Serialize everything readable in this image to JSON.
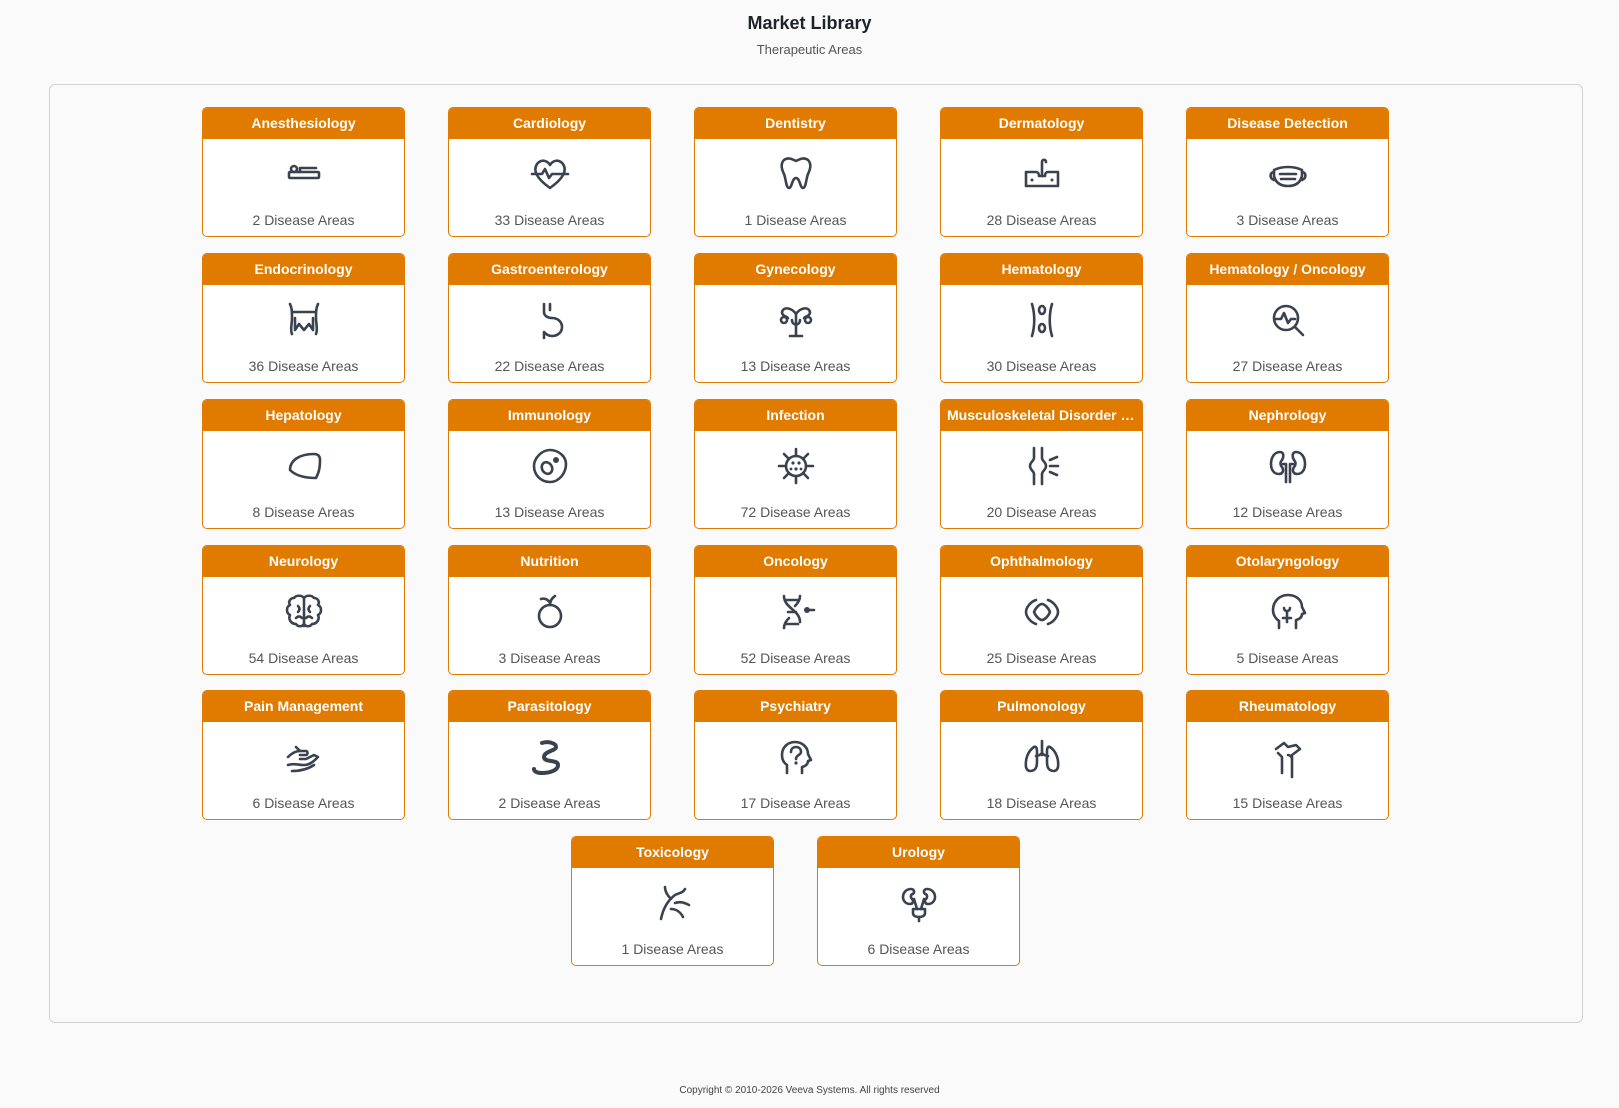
{
  "header": {
    "title": "Market Library",
    "subtitle": "Therapeutic Areas"
  },
  "areas": [
    {
      "name": "Anesthesiology",
      "count": "2 Disease Areas",
      "icon": "bed-icon"
    },
    {
      "name": "Cardiology",
      "count": "33 Disease Areas",
      "icon": "heart-pulse-icon"
    },
    {
      "name": "Dentistry",
      "count": "1 Disease Areas",
      "icon": "tooth-icon"
    },
    {
      "name": "Dermatology",
      "count": "28 Disease Areas",
      "icon": "skin-icon"
    },
    {
      "name": "Disease Detection",
      "count": "3 Disease Areas",
      "icon": "mask-icon"
    },
    {
      "name": "Endocrinology",
      "count": "36 Disease Areas",
      "icon": "thyroid-icon"
    },
    {
      "name": "Gastroenterology",
      "count": "22 Disease Areas",
      "icon": "stomach-icon"
    },
    {
      "name": "Gynecology",
      "count": "13 Disease Areas",
      "icon": "uterus-icon"
    },
    {
      "name": "Hematology",
      "count": "30 Disease Areas",
      "icon": "blood-vessel-icon"
    },
    {
      "name": "Hematology / Oncology",
      "count": "27 Disease Areas",
      "icon": "magnifier-pulse-icon"
    },
    {
      "name": "Hepatology",
      "count": "8 Disease Areas",
      "icon": "liver-icon"
    },
    {
      "name": "Immunology",
      "count": "13 Disease Areas",
      "icon": "immune-cell-icon"
    },
    {
      "name": "Infection",
      "count": "72 Disease Areas",
      "icon": "virus-icon"
    },
    {
      "name": "Musculoskeletal Disorder a...",
      "count": "20 Disease Areas",
      "icon": "joint-icon"
    },
    {
      "name": "Nephrology",
      "count": "12 Disease Areas",
      "icon": "kidneys-icon"
    },
    {
      "name": "Neurology",
      "count": "54 Disease Areas",
      "icon": "brain-icon"
    },
    {
      "name": "Nutrition",
      "count": "3 Disease Areas",
      "icon": "apple-icon"
    },
    {
      "name": "Oncology",
      "count": "52 Disease Areas",
      "icon": "dna-icon"
    },
    {
      "name": "Ophthalmology",
      "count": "25 Disease Areas",
      "icon": "eye-icon"
    },
    {
      "name": "Otolaryngology",
      "count": "5 Disease Areas",
      "icon": "head-throat-icon"
    },
    {
      "name": "Pain Management",
      "count": "6 Disease Areas",
      "icon": "hand-icon"
    },
    {
      "name": "Parasitology",
      "count": "2 Disease Areas",
      "icon": "worm-icon"
    },
    {
      "name": "Psychiatry",
      "count": "17 Disease Areas",
      "icon": "head-question-icon"
    },
    {
      "name": "Pulmonology",
      "count": "18 Disease Areas",
      "icon": "lungs-icon"
    },
    {
      "name": "Rheumatology",
      "count": "15 Disease Areas",
      "icon": "arm-joint-icon"
    },
    {
      "name": "Toxicology",
      "count": "1 Disease Areas",
      "icon": "nerve-icon"
    },
    {
      "name": "Urology",
      "count": "6 Disease Areas",
      "icon": "urinary-icon"
    }
  ],
  "footer": {
    "text": "Copyright © 2010-2026 Veeva Systems. All rights reserved"
  },
  "colors": {
    "accent": "#e07b00",
    "icon": "#3a4250"
  }
}
